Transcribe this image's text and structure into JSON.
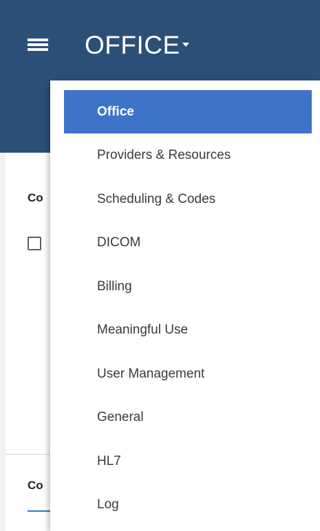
{
  "header": {
    "title": "OFFICE",
    "menu_icon": "hamburger-menu-icon",
    "caret_icon": "caret-down-icon",
    "background_color": "#2c4f78"
  },
  "page": {
    "section_heading_1": "Co",
    "section_heading_2": "Co"
  },
  "dropdown": {
    "active_color": "#3d74c7",
    "items": [
      {
        "label": "Office",
        "active": true
      },
      {
        "label": "Providers & Resources",
        "active": false
      },
      {
        "label": "Scheduling & Codes",
        "active": false
      },
      {
        "label": "DICOM",
        "active": false
      },
      {
        "label": "Billing",
        "active": false
      },
      {
        "label": "Meaningful Use",
        "active": false
      },
      {
        "label": "User Management",
        "active": false
      },
      {
        "label": "General",
        "active": false
      },
      {
        "label": "HL7",
        "active": false
      },
      {
        "label": "Log",
        "active": false
      }
    ]
  }
}
